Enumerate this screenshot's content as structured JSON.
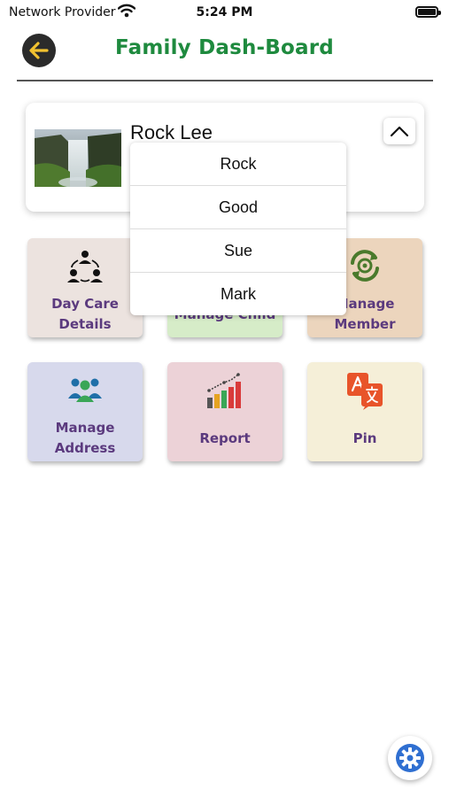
{
  "status_bar": {
    "carrier": "Network Provider",
    "time": "5:24 PM"
  },
  "header": {
    "title": "Family Dash-Board",
    "back_icon": "arrow-left-icon",
    "accent_color": "#1e8a3e"
  },
  "profile": {
    "name": "Rock Lee",
    "photo": "waterfall-landscape-image",
    "toggle_icon": "chevron-up-icon"
  },
  "dropdown": {
    "options": [
      "Rock",
      "Good",
      "Sue",
      "Mark"
    ]
  },
  "tiles": [
    {
      "label_line1": "Day Care",
      "label_line2": "Details",
      "icon": "group-people-icon",
      "bg": "#ece3df"
    },
    {
      "label_line1": "Manage Child",
      "label_line2": "",
      "icon": "child-icon",
      "bg": "#d6ecc8"
    },
    {
      "label_line1": "Manage",
      "label_line2": "Member",
      "icon": "refresh-gear-icon",
      "bg": "#ecd5bd"
    },
    {
      "label_line1": "Manage",
      "label_line2": "Address",
      "icon": "users-group-icon",
      "bg": "#d7d9ec"
    },
    {
      "label_line1": "Report",
      "label_line2": "",
      "icon": "bar-chart-icon",
      "bg": "#ecd2d7"
    },
    {
      "label_line1": "Pin",
      "label_line2": "",
      "icon": "translate-icon",
      "bg": "#f5efd8"
    }
  ],
  "settings": {
    "icon": "gear-icon"
  }
}
